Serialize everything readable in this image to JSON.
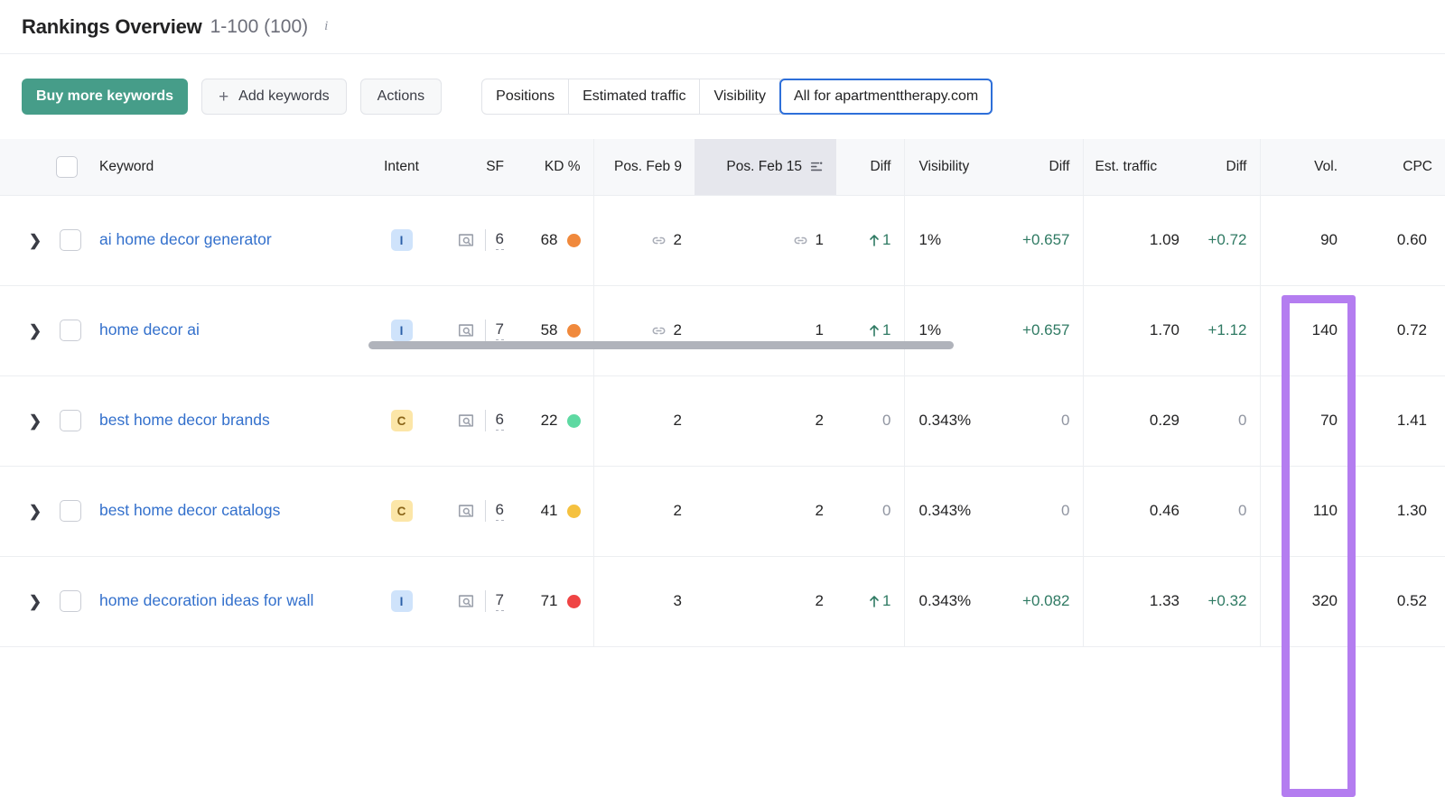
{
  "header": {
    "title": "Rankings Overview",
    "range": "1-100 (100)",
    "info_icon": "i"
  },
  "toolbar": {
    "buy_label": "Buy more keywords",
    "add_label": "Add keywords",
    "add_icon": "+",
    "actions_label": "Actions",
    "segments": [
      {
        "label": "Positions",
        "active": false
      },
      {
        "label": "Estimated traffic",
        "active": false
      },
      {
        "label": "Visibility",
        "active": false
      },
      {
        "label": "All for apartmenttherapy.com",
        "active": true
      }
    ]
  },
  "table": {
    "columns": [
      "Keyword",
      "Intent",
      "SF",
      "KD %",
      "Pos. Feb 9",
      "Pos. Feb 15",
      "Diff",
      "Visibility",
      "Diff",
      "Est. traffic",
      "Diff",
      "Vol.",
      "CPC"
    ],
    "sorted_column": "Pos. Feb 15",
    "rows": [
      {
        "keyword": "ai home decor generator",
        "intent": "I",
        "sf": "6",
        "kd": "68",
        "kd_color": "#f08c3c",
        "pos_feb9": "2",
        "pos_feb9_link": true,
        "pos_feb15": "1",
        "pos_feb15_link": true,
        "pos_diff": "1",
        "pos_diff_dir": "up",
        "visibility": "1%",
        "vis_diff": "+0.657",
        "est_traffic": "1.09",
        "traffic_diff": "+0.72",
        "vol": "90",
        "cpc": "0.60"
      },
      {
        "keyword": "home decor ai",
        "intent": "I",
        "sf": "7",
        "kd": "58",
        "kd_color": "#f08c3c",
        "pos_feb9": "2",
        "pos_feb9_link": true,
        "pos_feb15": "1",
        "pos_feb15_link": false,
        "pos_diff": "1",
        "pos_diff_dir": "up",
        "visibility": "1%",
        "vis_diff": "+0.657",
        "est_traffic": "1.70",
        "traffic_diff": "+1.12",
        "vol": "140",
        "cpc": "0.72"
      },
      {
        "keyword": "best home decor brands",
        "intent": "C",
        "sf": "6",
        "kd": "22",
        "kd_color": "#5fd9a0",
        "pos_feb9": "2",
        "pos_feb9_link": false,
        "pos_feb15": "2",
        "pos_feb15_link": false,
        "pos_diff": "0",
        "pos_diff_dir": "zero",
        "visibility": "0.343%",
        "vis_diff": "0",
        "est_traffic": "0.29",
        "traffic_diff": "0",
        "vol": "70",
        "cpc": "1.41"
      },
      {
        "keyword": "best home decor catalogs",
        "intent": "C",
        "sf": "6",
        "kd": "41",
        "kd_color": "#f5c councils"
      }
    ]
  }
}
